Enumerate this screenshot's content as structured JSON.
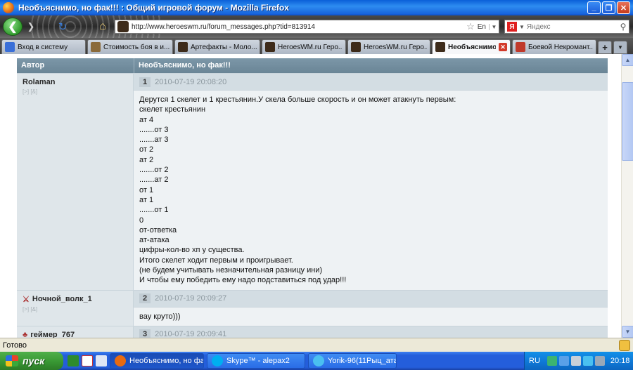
{
  "window": {
    "title": "Необъяснимо, но фак!!! : Общий игровой форум - Mozilla Firefox",
    "minimize": "_",
    "maximize": "❐",
    "close": "✕"
  },
  "navbar": {
    "back": "❮",
    "forward": "❯",
    "reload": "↻",
    "home": "⌂",
    "url": "http://www.heroeswm.ru/forum_messages.php?tid=813914",
    "star": "☆",
    "lang": "En",
    "search_logo": "Я",
    "search_placeholder": "Яндекс",
    "search_icon": "⚲"
  },
  "tabs": [
    {
      "label": "Вход в систему",
      "icon_color": "#3a6fd8",
      "active": false,
      "closable": false
    },
    {
      "label": "Стоимость боя в и...",
      "icon_color": "#8a6a3a",
      "active": false,
      "closable": false
    },
    {
      "label": "Артефакты - Моло...",
      "icon_color": "#3d2b1a",
      "active": false,
      "closable": false
    },
    {
      "label": "HeroesWM.ru Геро...",
      "icon_color": "#3d2b1a",
      "active": false,
      "closable": false
    },
    {
      "label": "HeroesWM.ru Геро...",
      "icon_color": "#3d2b1a",
      "active": false,
      "closable": false
    },
    {
      "label": "Необъяснимо...",
      "icon_color": "#3d2b1a",
      "active": true,
      "closable": true
    },
    {
      "label": "Боевой Некромант...",
      "icon_color": "#c0392b",
      "active": false,
      "closable": false
    }
  ],
  "tab_new": "+",
  "tab_list": "▼",
  "forum": {
    "col_author": "Автор",
    "col_topic": "Необъяснимо, но фак!!!",
    "posts": [
      {
        "author": "Rolaman",
        "badge": "",
        "number": "1",
        "date": "2010-07-19 20:08:20",
        "lines": [
          "Дерутся 1 скелет и 1 крестьянин.У скела больше скорость и он может атакнуть первым:",
          "скелет крестьянин",
          "ат 4",
          ".......от 3",
          ".......ат 3",
          "от 2",
          "ат 2",
          ".......от 2",
          ".......ат 2",
          "от 1",
          "ат 1",
          ".......от 1",
          "0",
          "от-ответка",
          "ат-атака",
          "цифры-кол-во хп у существа.",
          "Итого скелет ходит первым и проигрывает.",
          "(не будем учитывать незначительная разницу ини)",
          "И чтобы ему победить ему надо подставиться под удар!!!"
        ]
      },
      {
        "author": "Ночной_волк_1",
        "badge": "⚔",
        "number": "2",
        "date": "2010-07-19 20:09:27",
        "lines": [
          "вау круто)))"
        ]
      },
      {
        "author": "геймер_767",
        "badge": "♣",
        "number": "3",
        "date": "2010-07-19 20:09:41",
        "lines": []
      }
    ],
    "mini_links": "[>] [&]"
  },
  "status": "Готово",
  "taskbar": {
    "start": "пуск",
    "buttons": [
      {
        "label": "Необъяснимо, но фа...",
        "active": true,
        "icon_color": "#e86a10"
      },
      {
        "label": "Skype™ - alepax2",
        "active": false,
        "icon_color": "#00aff0"
      },
      {
        "label": "Yorik-96(11Рыц_ата...",
        "active": false,
        "icon_color": "#4ac0f0"
      }
    ],
    "lang": "RU",
    "clock": "20:18"
  },
  "colors": {
    "header": "#6a8596",
    "author_bg": "#dfe6ea",
    "post_bg": "#eef2f4",
    "meta_bg": "#d3dde3"
  }
}
